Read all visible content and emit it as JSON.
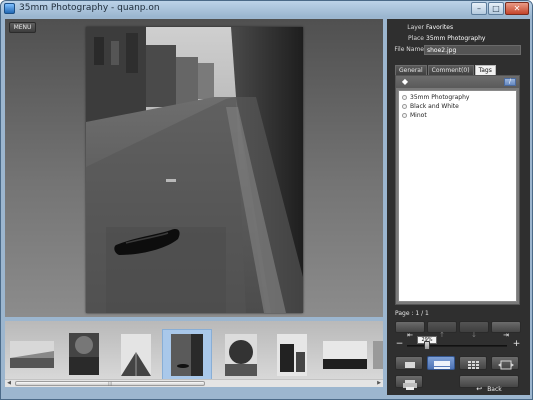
{
  "window": {
    "title": "35mm Photography - quanp.on",
    "minimize": "–",
    "maximize": "□",
    "close": "✕"
  },
  "viewer": {
    "menu_label": "MENU"
  },
  "properties": {
    "layer_label": "Layer",
    "layer_value": "Favorites",
    "place_label": "Place",
    "place_value": "35mm Photography",
    "filename_label": "File Name",
    "filename_value": "shoe2.jpg"
  },
  "tabs": [
    {
      "label": "General"
    },
    {
      "label": "Comment(0)"
    },
    {
      "label": "Tags"
    }
  ],
  "tags": {
    "add_icon": "tag-icon",
    "edit_icon": "pencil-icon",
    "items": [
      {
        "label": "35mm Photography"
      },
      {
        "label": "Black and White"
      },
      {
        "label": "Minot"
      }
    ]
  },
  "pagination": {
    "page_text": "Page : 1 / 1"
  },
  "zoom": {
    "value_text": "29%",
    "level_fraction": 0.2
  },
  "nav": {
    "first": "⇤",
    "prev": "↑",
    "next": "↓",
    "last": "⇥"
  },
  "views": {
    "single": "single-view-icon",
    "strip": "strip-view-icon",
    "grid": "grid-view-icon",
    "fit": "fit-view-icon",
    "print": "print-icon"
  },
  "back": {
    "label": "Back"
  },
  "filmstrip": {
    "thumb_count": 8,
    "selected_index": 3
  },
  "colors": {
    "selected_thumb": "#a9c8ea",
    "active_button": "#5f83c2",
    "panel_bg": "#2f2f2f"
  }
}
